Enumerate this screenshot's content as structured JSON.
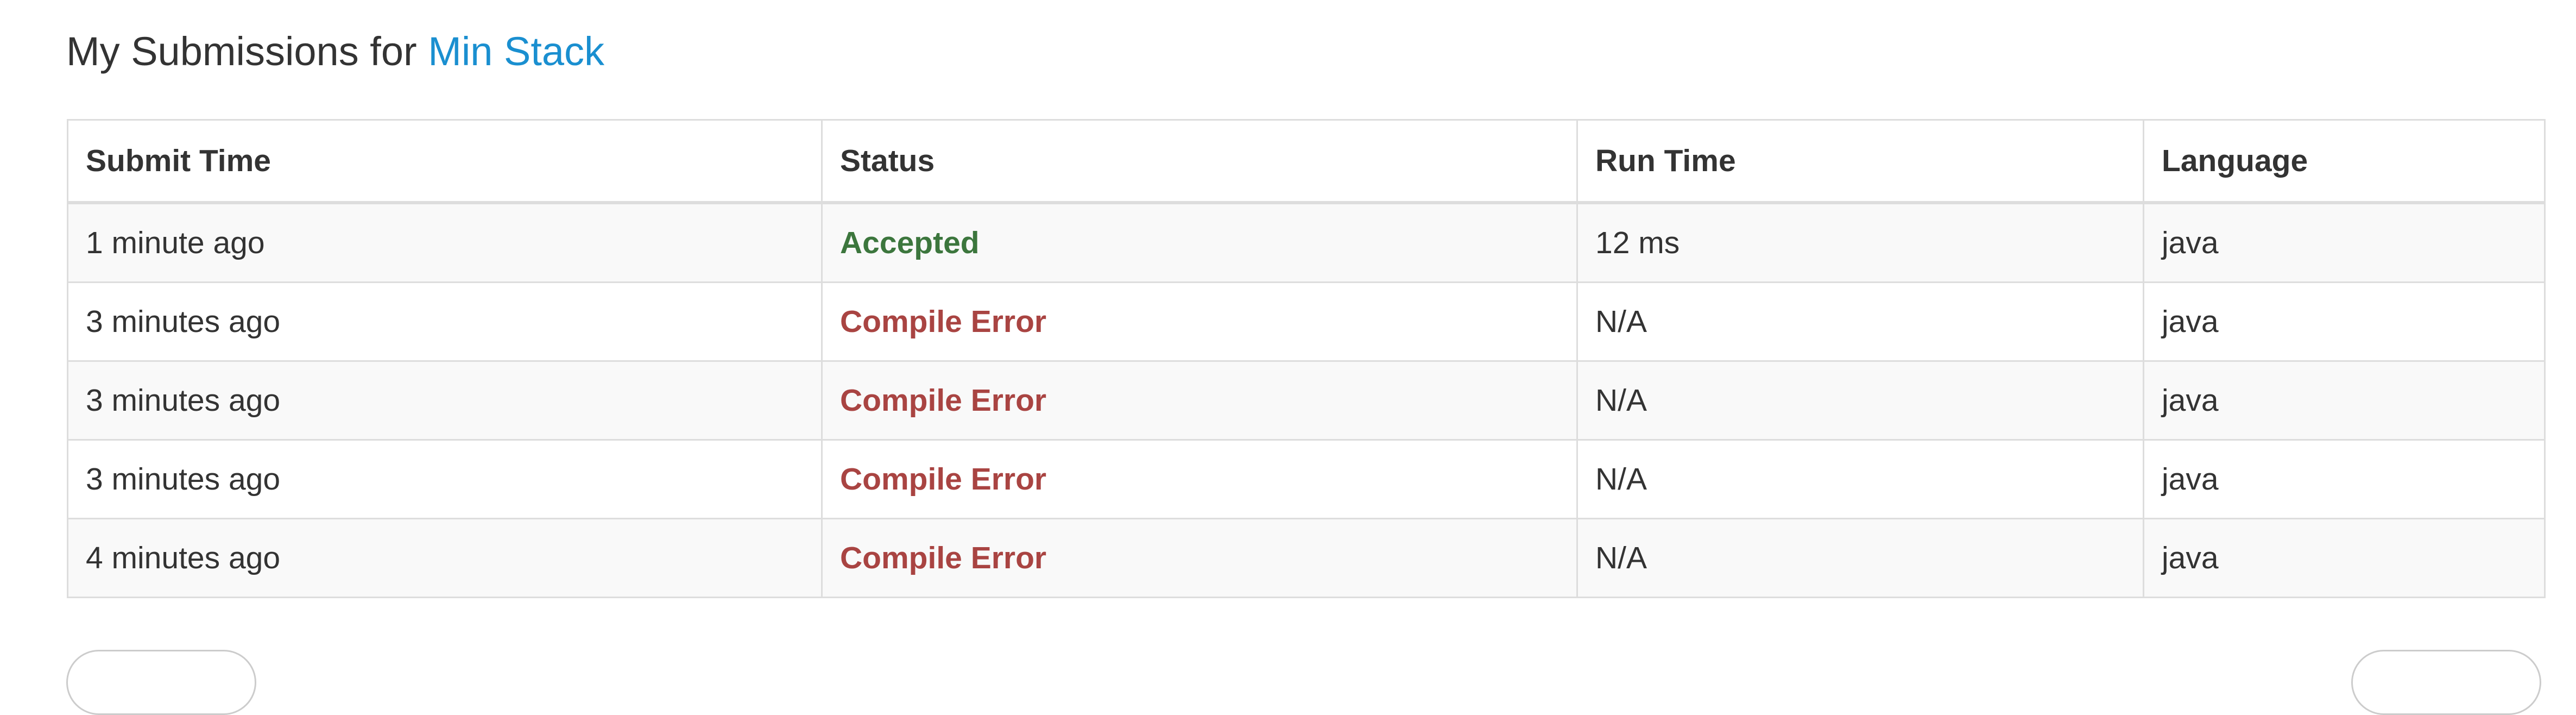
{
  "heading": {
    "prefix": "My Submissions for",
    "problem_name": "Min Stack",
    "link_color": "#1a8fd0"
  },
  "table": {
    "columns": [
      "Submit Time",
      "Status",
      "Run Time",
      "Language"
    ],
    "rows": [
      {
        "submit_time": "1 minute ago",
        "status": "Accepted",
        "status_type": "accepted",
        "run_time": "12 ms",
        "language": "java"
      },
      {
        "submit_time": "3 minutes ago",
        "status": "Compile Error",
        "status_type": "error",
        "run_time": "N/A",
        "language": "java"
      },
      {
        "submit_time": "3 minutes ago",
        "status": "Compile Error",
        "status_type": "error",
        "run_time": "N/A",
        "language": "java"
      },
      {
        "submit_time": "3 minutes ago",
        "status": "Compile Error",
        "status_type": "error",
        "run_time": "N/A",
        "language": "java"
      },
      {
        "submit_time": "4 minutes ago",
        "status": "Compile Error",
        "status_type": "error",
        "run_time": "N/A",
        "language": "java"
      }
    ]
  },
  "colors": {
    "accepted": "#3c763d",
    "error": "#a94442",
    "border": "#dddddd",
    "stripe": "#f9f9f9"
  }
}
